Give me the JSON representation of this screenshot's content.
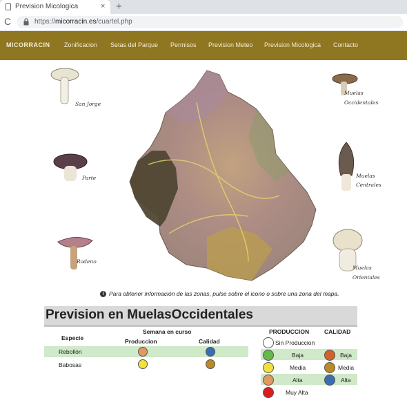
{
  "browser": {
    "tab_title": "Prevision Micologica",
    "tab_close": "×",
    "new_tab": "+",
    "reload": "C",
    "url_scheme": "https://",
    "url_host": "micorracin.es",
    "url_path": "/cuartel.php"
  },
  "nav": {
    "brand": "MICORRACIN",
    "items": [
      "Zonificacion",
      "Setas del Parque",
      "Permisos",
      "Prevision Meteo",
      "Prevision Micologica",
      "Contacto"
    ]
  },
  "map": {
    "mushroom_labels": [
      "San Jorge",
      "Muelas Occidentales",
      "Parte",
      "Muelas Centrales",
      "Rodeno",
      "Muelas Orientales"
    ]
  },
  "hint": "Para obtener información de las zonas, pulse sobre el icono o sobre una zona del mapa.",
  "section": {
    "title": "Prevision en MuelasOccidentales"
  },
  "table": {
    "col_especie": "Especie",
    "col_semana": "Semana en curso",
    "col_produccion": "Produccion",
    "col_calidad": "Calidad",
    "rows": [
      {
        "especie": "Rebollón",
        "produccion_color": "#e09a60",
        "calidad_color": "#3b6db5"
      },
      {
        "especie": "Babosas",
        "produccion_color": "#f2e13a",
        "calidad_color": "#b98a2a"
      }
    ]
  },
  "legend": {
    "produccion_header": "PRODUCCION",
    "calidad_header": "CALIDAD",
    "produccion": [
      {
        "label": "Sin Produccion",
        "color": "#ffffff"
      },
      {
        "label": "Baja",
        "color": "#67b84a"
      },
      {
        "label": "Media",
        "color": "#f2e13a"
      },
      {
        "label": "Alta",
        "color": "#e09a60"
      },
      {
        "label": "Muy Alta",
        "color": "#d61f1f"
      }
    ],
    "calidad": [
      {
        "label": "Baja",
        "color": "#d2632a"
      },
      {
        "label": "Media",
        "color": "#b98a2a"
      },
      {
        "label": "Alta",
        "color": "#3b6db5"
      }
    ]
  },
  "colors": {
    "navbar": "#8f7621",
    "highlight_row": "#cfe9c9"
  }
}
